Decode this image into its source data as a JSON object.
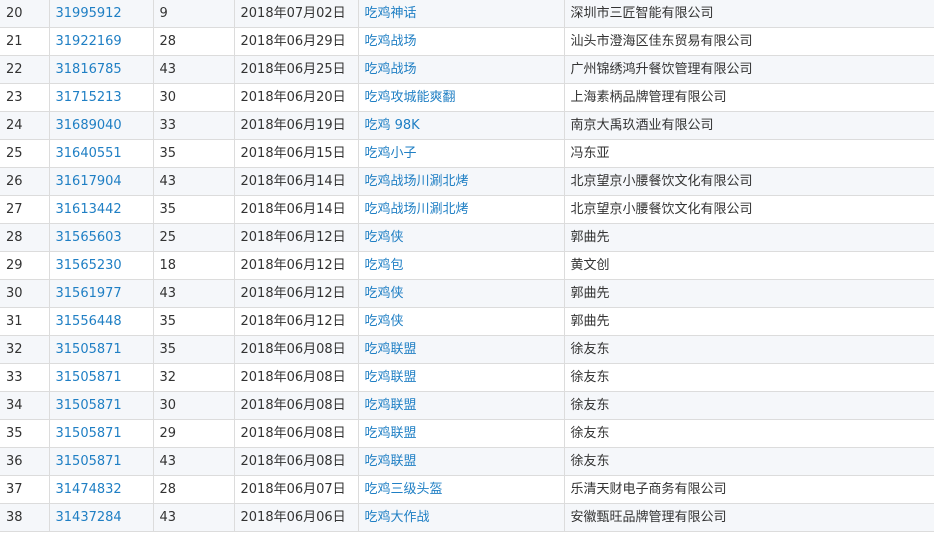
{
  "colors": {
    "link": "#1f7fc4",
    "text": "#333333",
    "row_alt": "#f5f7fa",
    "border": "#dcdcdc"
  },
  "rows": [
    {
      "idx": "20",
      "reg_no": "31995912",
      "class": "9",
      "date": "2018年07月02日",
      "mark": "吃鸡神话",
      "applicant": "深圳市三匠智能有限公司"
    },
    {
      "idx": "21",
      "reg_no": "31922169",
      "class": "28",
      "date": "2018年06月29日",
      "mark": "吃鸡战场",
      "applicant": "汕头市澄海区佳东贸易有限公司"
    },
    {
      "idx": "22",
      "reg_no": "31816785",
      "class": "43",
      "date": "2018年06月25日",
      "mark": "吃鸡战场",
      "applicant": "广州锦绣鸿升餐饮管理有限公司"
    },
    {
      "idx": "23",
      "reg_no": "31715213",
      "class": "30",
      "date": "2018年06月20日",
      "mark": "吃鸡攻城能爽翻",
      "applicant": "上海素柄品牌管理有限公司"
    },
    {
      "idx": "24",
      "reg_no": "31689040",
      "class": "33",
      "date": "2018年06月19日",
      "mark": "吃鸡 98K",
      "applicant": "南京大禹玖酒业有限公司"
    },
    {
      "idx": "25",
      "reg_no": "31640551",
      "class": "35",
      "date": "2018年06月15日",
      "mark": "吃鸡小子",
      "applicant": "冯东亚"
    },
    {
      "idx": "26",
      "reg_no": "31617904",
      "class": "43",
      "date": "2018年06月14日",
      "mark": "吃鸡战场川涮北烤",
      "applicant": "北京望京小腰餐饮文化有限公司"
    },
    {
      "idx": "27",
      "reg_no": "31613442",
      "class": "35",
      "date": "2018年06月14日",
      "mark": "吃鸡战场川涮北烤",
      "applicant": "北京望京小腰餐饮文化有限公司"
    },
    {
      "idx": "28",
      "reg_no": "31565603",
      "class": "25",
      "date": "2018年06月12日",
      "mark": "吃鸡侠",
      "applicant": "郭曲先"
    },
    {
      "idx": "29",
      "reg_no": "31565230",
      "class": "18",
      "date": "2018年06月12日",
      "mark": "吃鸡包",
      "applicant": "黄文创"
    },
    {
      "idx": "30",
      "reg_no": "31561977",
      "class": "43",
      "date": "2018年06月12日",
      "mark": "吃鸡侠",
      "applicant": "郭曲先"
    },
    {
      "idx": "31",
      "reg_no": "31556448",
      "class": "35",
      "date": "2018年06月12日",
      "mark": "吃鸡侠",
      "applicant": "郭曲先"
    },
    {
      "idx": "32",
      "reg_no": "31505871",
      "class": "35",
      "date": "2018年06月08日",
      "mark": "吃鸡联盟",
      "applicant": "徐友东"
    },
    {
      "idx": "33",
      "reg_no": "31505871",
      "class": "32",
      "date": "2018年06月08日",
      "mark": "吃鸡联盟",
      "applicant": "徐友东"
    },
    {
      "idx": "34",
      "reg_no": "31505871",
      "class": "30",
      "date": "2018年06月08日",
      "mark": "吃鸡联盟",
      "applicant": "徐友东"
    },
    {
      "idx": "35",
      "reg_no": "31505871",
      "class": "29",
      "date": "2018年06月08日",
      "mark": "吃鸡联盟",
      "applicant": "徐友东"
    },
    {
      "idx": "36",
      "reg_no": "31505871",
      "class": "43",
      "date": "2018年06月08日",
      "mark": "吃鸡联盟",
      "applicant": "徐友东"
    },
    {
      "idx": "37",
      "reg_no": "31474832",
      "class": "28",
      "date": "2018年06月07日",
      "mark": "吃鸡三级头盔",
      "applicant": "乐清天财电子商务有限公司"
    },
    {
      "idx": "38",
      "reg_no": "31437284",
      "class": "43",
      "date": "2018年06月06日",
      "mark": "吃鸡大作战",
      "applicant": "安徽甄旺品牌管理有限公司"
    }
  ]
}
